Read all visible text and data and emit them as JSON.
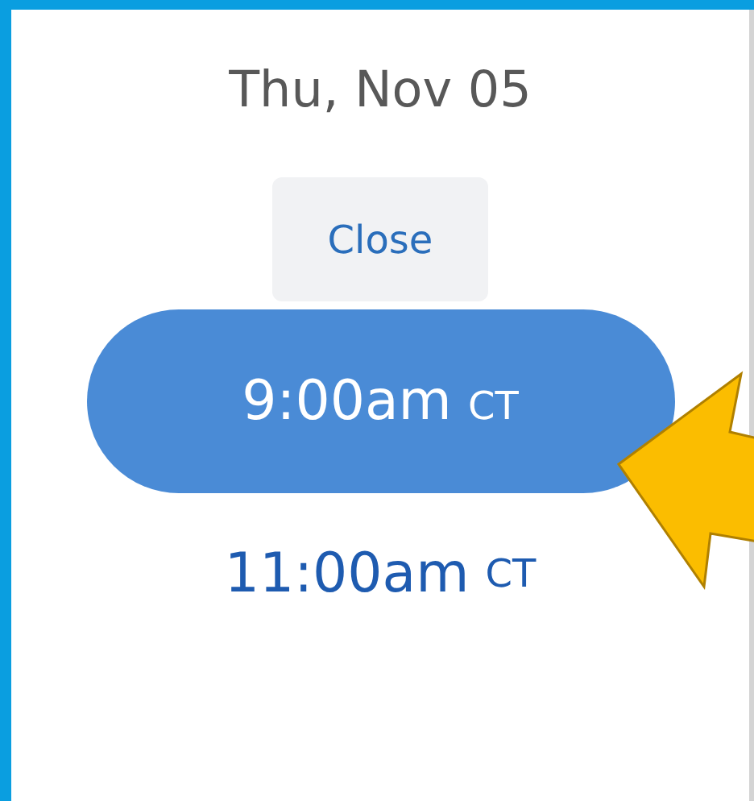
{
  "date": "Thu, Nov 05",
  "close_button": {
    "label": "Close"
  },
  "times": [
    {
      "time": "9:00am",
      "zone": "CT",
      "selected": true
    },
    {
      "time": "11:00am",
      "zone": "CT",
      "selected": false
    }
  ]
}
